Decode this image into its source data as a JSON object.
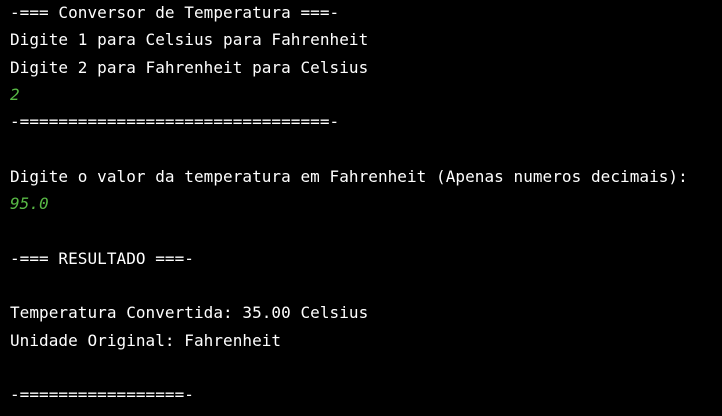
{
  "colors": {
    "background": "#000000",
    "output_text": "#ffffff",
    "user_input_text": "#58b845"
  },
  "console": {
    "lines": [
      {
        "text": "-=== Conversor de Temperatura ===-",
        "kind": "output"
      },
      {
        "text": "Digite 1 para Celsius para Fahrenheit",
        "kind": "output"
      },
      {
        "text": "Digite 2 para Fahrenheit para Celsius",
        "kind": "output"
      },
      {
        "text": "2",
        "kind": "input"
      },
      {
        "text": "-================================-",
        "kind": "output"
      },
      {
        "text": "",
        "kind": "blank"
      },
      {
        "text": "Digite o valor da temperatura em Fahrenheit (Apenas numeros decimais):",
        "kind": "output"
      },
      {
        "text": "95.0",
        "kind": "input"
      },
      {
        "text": "",
        "kind": "blank"
      },
      {
        "text": "-=== RESULTADO ===-",
        "kind": "output"
      },
      {
        "text": "",
        "kind": "blank"
      },
      {
        "text": "Temperatura Convertida: 35.00 Celsius",
        "kind": "output"
      },
      {
        "text": "Unidade Original: Fahrenheit",
        "kind": "output"
      },
      {
        "text": "",
        "kind": "blank"
      },
      {
        "text": "-=================-",
        "kind": "output"
      }
    ]
  }
}
